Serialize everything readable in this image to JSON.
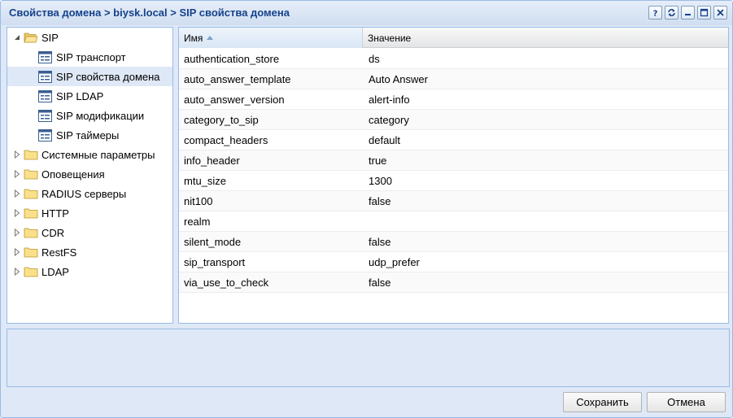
{
  "window": {
    "title": "Свойства домена > biysk.local > SIP свойства домена",
    "tools": [
      "help-icon",
      "refresh-icon",
      "minimize-icon",
      "maximize-icon",
      "close-icon"
    ]
  },
  "tree": {
    "root": {
      "label": "SIP",
      "expanded": true
    },
    "children": [
      {
        "label": "SIP транспорт",
        "selected": false
      },
      {
        "label": "SIP свойства домена",
        "selected": true
      },
      {
        "label": "SIP LDAP",
        "selected": false
      },
      {
        "label": "SIP модификации",
        "selected": false
      },
      {
        "label": "SIP таймеры",
        "selected": false
      }
    ],
    "folders": [
      {
        "label": "Системные параметры"
      },
      {
        "label": "Оповещения"
      },
      {
        "label": "RADIUS серверы"
      },
      {
        "label": "HTTP"
      },
      {
        "label": "CDR"
      },
      {
        "label": "RestFS"
      },
      {
        "label": "LDAP"
      }
    ]
  },
  "grid": {
    "columns": {
      "name": "Имя",
      "value": "Значение"
    },
    "sort": "ascending",
    "rows": [
      {
        "name": "authentication_store",
        "value": "ds"
      },
      {
        "name": "auto_answer_template",
        "value": "Auto Answer"
      },
      {
        "name": "auto_answer_version",
        "value": "alert-info"
      },
      {
        "name": "category_to_sip",
        "value": "category"
      },
      {
        "name": "compact_headers",
        "value": "default"
      },
      {
        "name": "info_header",
        "value": "true"
      },
      {
        "name": "mtu_size",
        "value": "1300"
      },
      {
        "name": "nit100",
        "value": "false"
      },
      {
        "name": "realm",
        "value": ""
      },
      {
        "name": "silent_mode",
        "value": "false"
      },
      {
        "name": "sip_transport",
        "value": "udp_prefer"
      },
      {
        "name": "via_use_to_check",
        "value": "false"
      }
    ]
  },
  "buttons": {
    "save": "Сохранить",
    "cancel": "Отмена"
  },
  "colors": {
    "title": "#15428b",
    "border": "#99bbe8",
    "panel": "#dfe8f6",
    "selected": "#dfe8f6"
  }
}
